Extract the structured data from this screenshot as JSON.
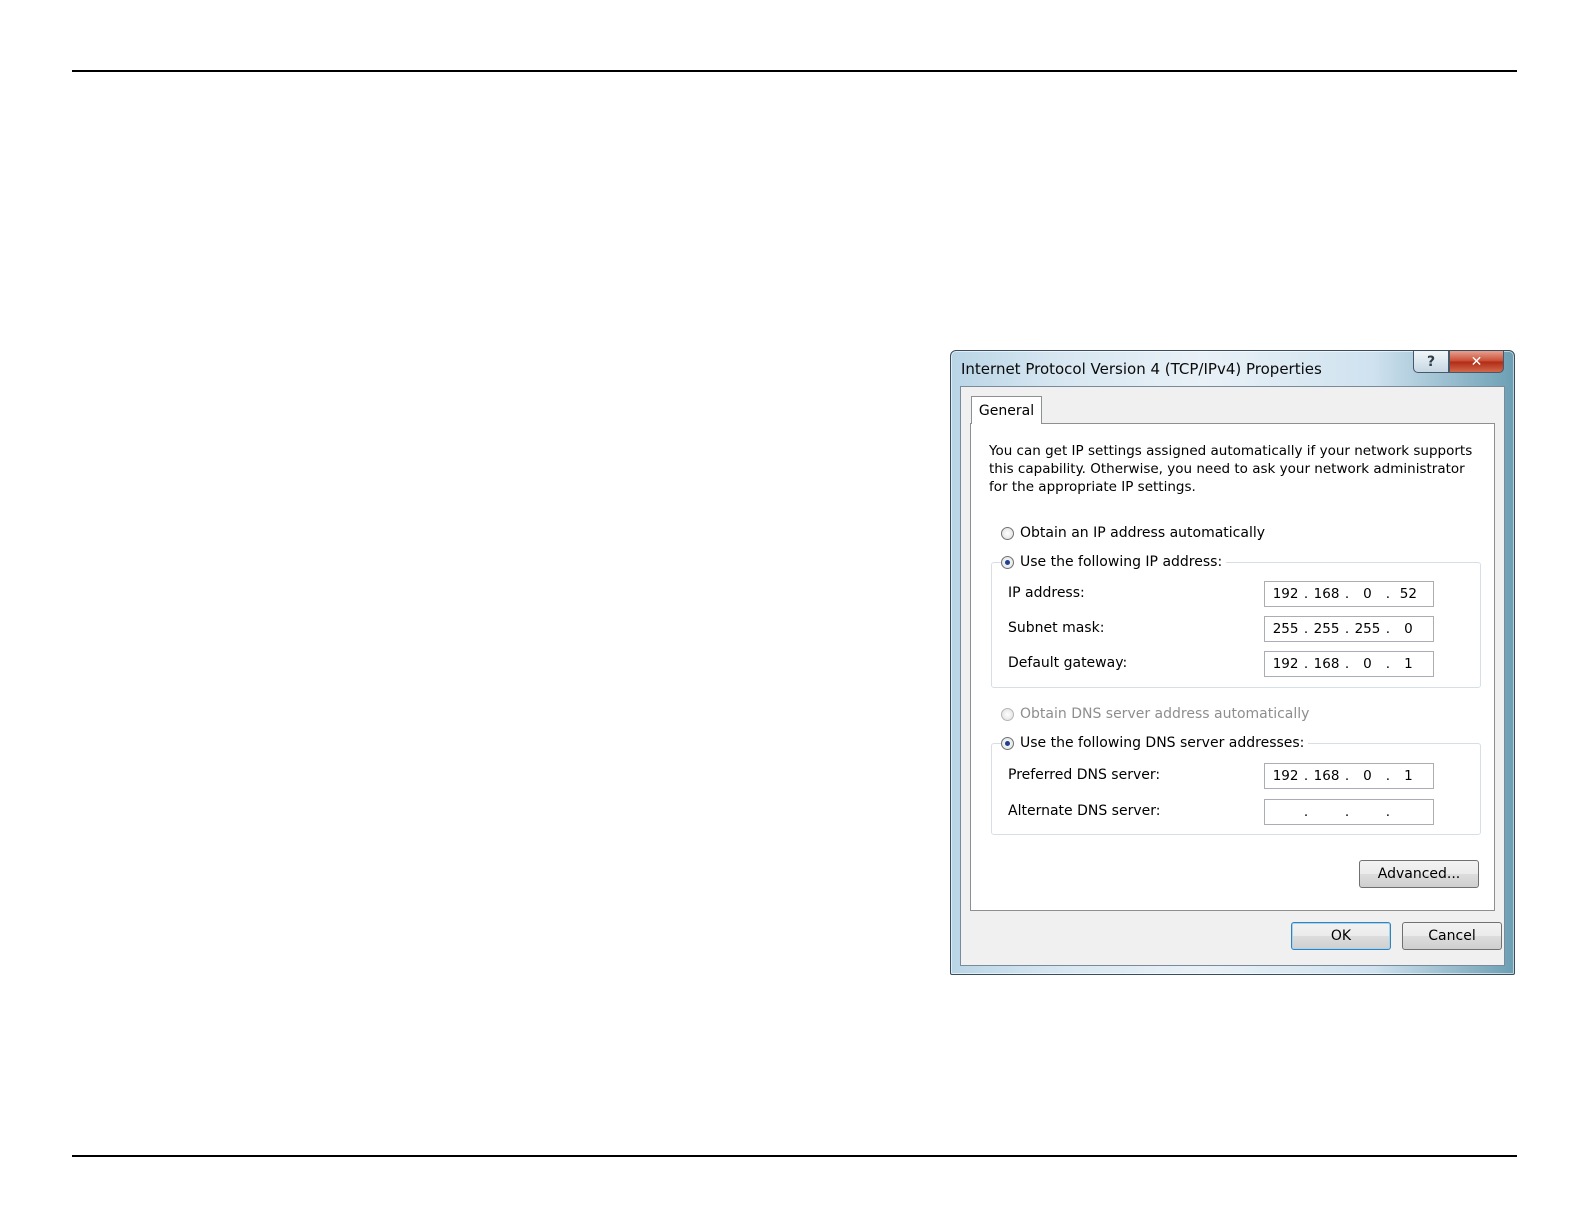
{
  "window": {
    "title": "Internet Protocol Version 4 (TCP/IPv4) Properties",
    "help_glyph": "?",
    "close_glyph": "✕"
  },
  "tab": {
    "label": "General"
  },
  "description": "You can get IP settings assigned automatically if your network supports this capability. Otherwise, you need to ask your network administrator for the appropriate IP settings.",
  "ip_mode": {
    "auto_label": "Obtain an IP address automatically",
    "manual_label": "Use the following IP address:",
    "selected": "manual"
  },
  "ip_fields": [
    {
      "label": "IP address:",
      "octets": [
        "192",
        "168",
        "0",
        "52"
      ]
    },
    {
      "label": "Subnet mask:",
      "octets": [
        "255",
        "255",
        "255",
        "0"
      ]
    },
    {
      "label": "Default gateway:",
      "octets": [
        "192",
        "168",
        "0",
        "1"
      ]
    }
  ],
  "dns_mode": {
    "auto_label": "Obtain DNS server address automatically",
    "manual_label": "Use the following DNS server addresses:",
    "selected": "manual",
    "auto_disabled": true
  },
  "dns_fields": [
    {
      "label": "Preferred DNS server:",
      "octets": [
        "192",
        "168",
        "0",
        "1"
      ]
    },
    {
      "label": "Alternate DNS server:",
      "octets": [
        "",
        "",
        "",
        ""
      ]
    }
  ],
  "buttons": {
    "advanced": "Advanced...",
    "ok": "OK",
    "cancel": "Cancel"
  },
  "icons": {
    "help": "help-icon",
    "close": "close-icon"
  }
}
